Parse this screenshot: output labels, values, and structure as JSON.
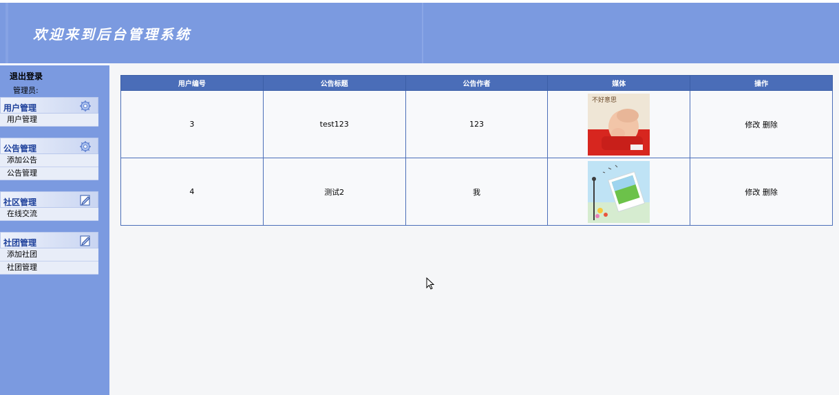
{
  "header": {
    "title": "欢迎来到后台管理系统"
  },
  "sidebar": {
    "logout_label": "退出登录",
    "admin_label": "管理员:",
    "groups": [
      {
        "title": "用户管理",
        "icon": "gear-icon",
        "items": [
          "用户管理"
        ]
      },
      {
        "title": "公告管理",
        "icon": "gear-icon",
        "items": [
          "添加公告",
          "公告管理"
        ]
      },
      {
        "title": "社区管理",
        "icon": "edit-icon",
        "items": [
          "在线交流"
        ]
      },
      {
        "title": "社团管理",
        "icon": "edit-icon",
        "items": [
          "添加社团",
          "社团管理"
        ]
      }
    ]
  },
  "table": {
    "headers": [
      "用户编号",
      "公告标题",
      "公告作者",
      "媒体",
      "操作"
    ],
    "rows": [
      {
        "id": "3",
        "title": "test123",
        "author": "123",
        "media": "baby-photo",
        "edit": "修改",
        "delete": "删除"
      },
      {
        "id": "4",
        "title": "测试2",
        "author": "我",
        "media": "landscape-photo",
        "edit": "修改",
        "delete": "删除"
      }
    ]
  },
  "media_caption": "不好意思",
  "colors": {
    "header_bg": "#7b9ae0",
    "table_head": "#4a6db8",
    "menu_title": "#1c3f9a"
  }
}
